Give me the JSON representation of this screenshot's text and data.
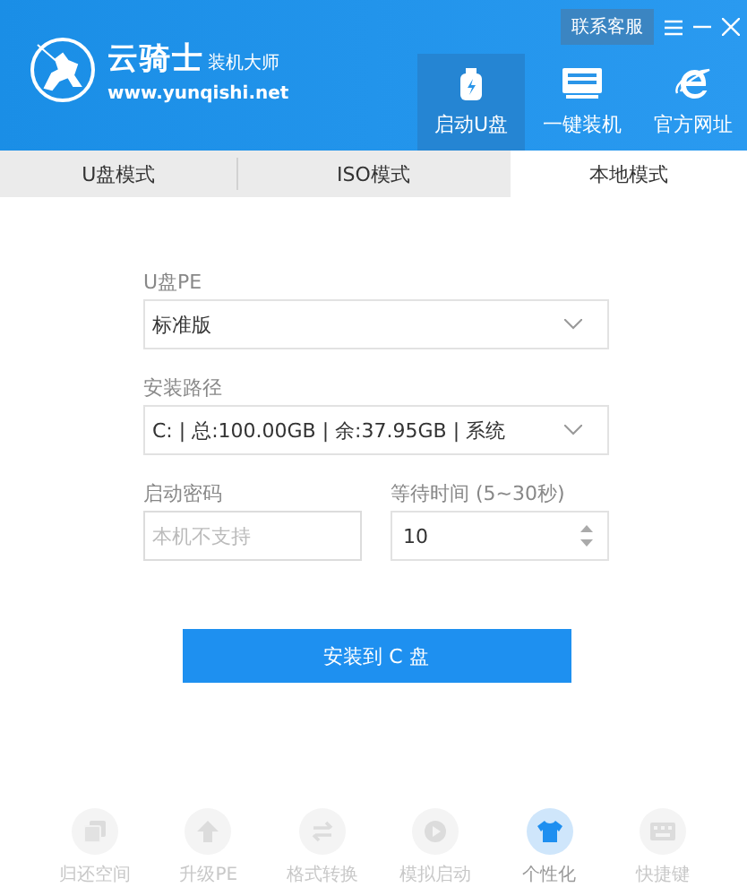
{
  "header": {
    "brand": "云骑士",
    "brand_sub": "装机大师",
    "url": "www.yunqishi.net",
    "contact_button": "联系客服",
    "nav": [
      {
        "label": "启动U盘",
        "kind": "usb",
        "selected": true
      },
      {
        "label": "一键装机",
        "kind": "monitor",
        "selected": false
      },
      {
        "label": "官方网址",
        "kind": "browser",
        "selected": false
      }
    ]
  },
  "tabs": [
    {
      "label": "U盘模式",
      "selected": false
    },
    {
      "label": "ISO模式",
      "selected": false
    },
    {
      "label": "本地模式",
      "selected": true
    }
  ],
  "form": {
    "pe": {
      "label": "U盘PE",
      "value": "标准版"
    },
    "path": {
      "label": "安装路径",
      "value": "C: | 总:100.00GB | 余:37.95GB | 系统"
    },
    "password": {
      "label": "启动密码",
      "placeholder": "本机不支持",
      "disabled": true
    },
    "wait": {
      "label": "等待时间 (5~30秒)",
      "value": "10"
    },
    "install_button": "安装到 C 盘"
  },
  "tools": [
    {
      "label": "归还空间",
      "kind": "copy",
      "selected": false
    },
    {
      "label": "升级PE",
      "kind": "up",
      "selected": false
    },
    {
      "label": "格式转换",
      "kind": "swap",
      "selected": false
    },
    {
      "label": "模拟启动",
      "kind": "play",
      "selected": false
    },
    {
      "label": "个性化",
      "kind": "shirt",
      "selected": true
    },
    {
      "label": "快捷键",
      "kind": "keys",
      "selected": false
    }
  ]
}
